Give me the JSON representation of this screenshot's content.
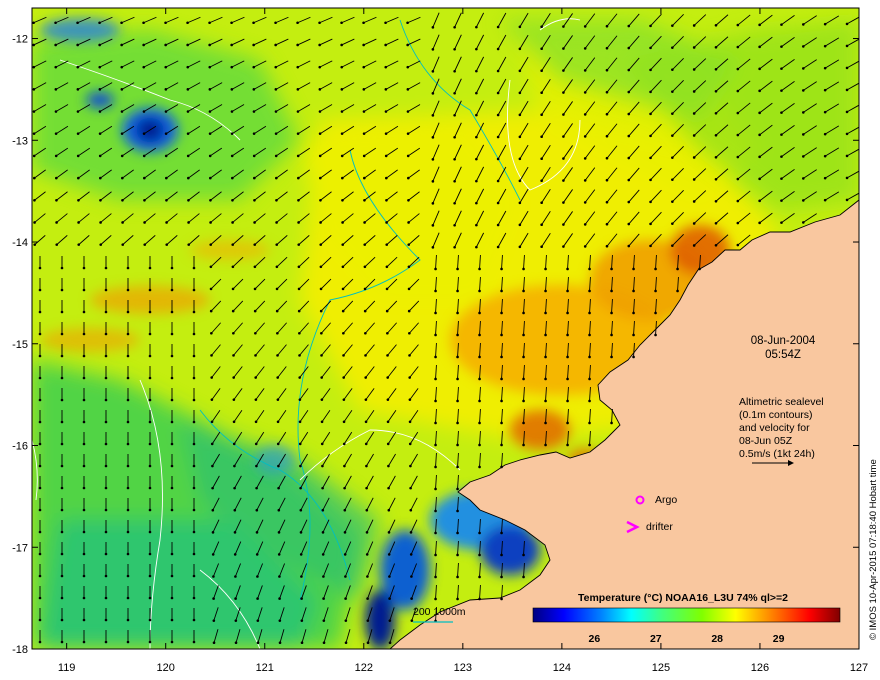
{
  "map": {
    "lon_ticks": [
      "119",
      "120",
      "121",
      "122",
      "123",
      "124",
      "125",
      "126",
      "127"
    ],
    "lat_ticks": [
      "-12",
      "-13",
      "-14",
      "-15",
      "-16",
      "-17",
      "-18"
    ],
    "lon_range": [
      118.65,
      127.0
    ],
    "lat_range": [
      -11.7,
      -18.0
    ]
  },
  "datetime": {
    "date": "08-Jun-2004",
    "time": "05:54Z"
  },
  "altimetry": {
    "line1": "Altimetric sealevel",
    "line2": "(0.1m contours)",
    "line3": "and velocity for",
    "line4": "08-Jun 05Z",
    "line5": "0.5m/s (1kt 24h)"
  },
  "markers": {
    "argo_label": "Argo",
    "drifter_label": "drifter",
    "color": "#ff00ff",
    "argo_lon_lat": [
      124.78,
      -16.52
    ],
    "drifter_lon_lat": [
      124.78,
      -16.78
    ]
  },
  "isobath_legend": {
    "text": "200  1000m",
    "color": "#00bfc0"
  },
  "colorbar": {
    "title": "Temperature (°C) NOAA16_L3U 74% ql>=2",
    "ticks": [
      "26",
      "27",
      "28",
      "29"
    ],
    "range": [
      25.0,
      30.0
    ],
    "colors": [
      "#000080",
      "#0000ff",
      "#0080ff",
      "#00ffff",
      "#40ff80",
      "#80ff00",
      "#ffff00",
      "#ff8000",
      "#ff0000",
      "#800000"
    ]
  },
  "credit": "© IMOS 10-Apr-2015 07:18:40 Hobart time",
  "colors": {
    "land": "#f9c79f",
    "sea_dominant": "#c8f000",
    "coast": "#000000"
  }
}
